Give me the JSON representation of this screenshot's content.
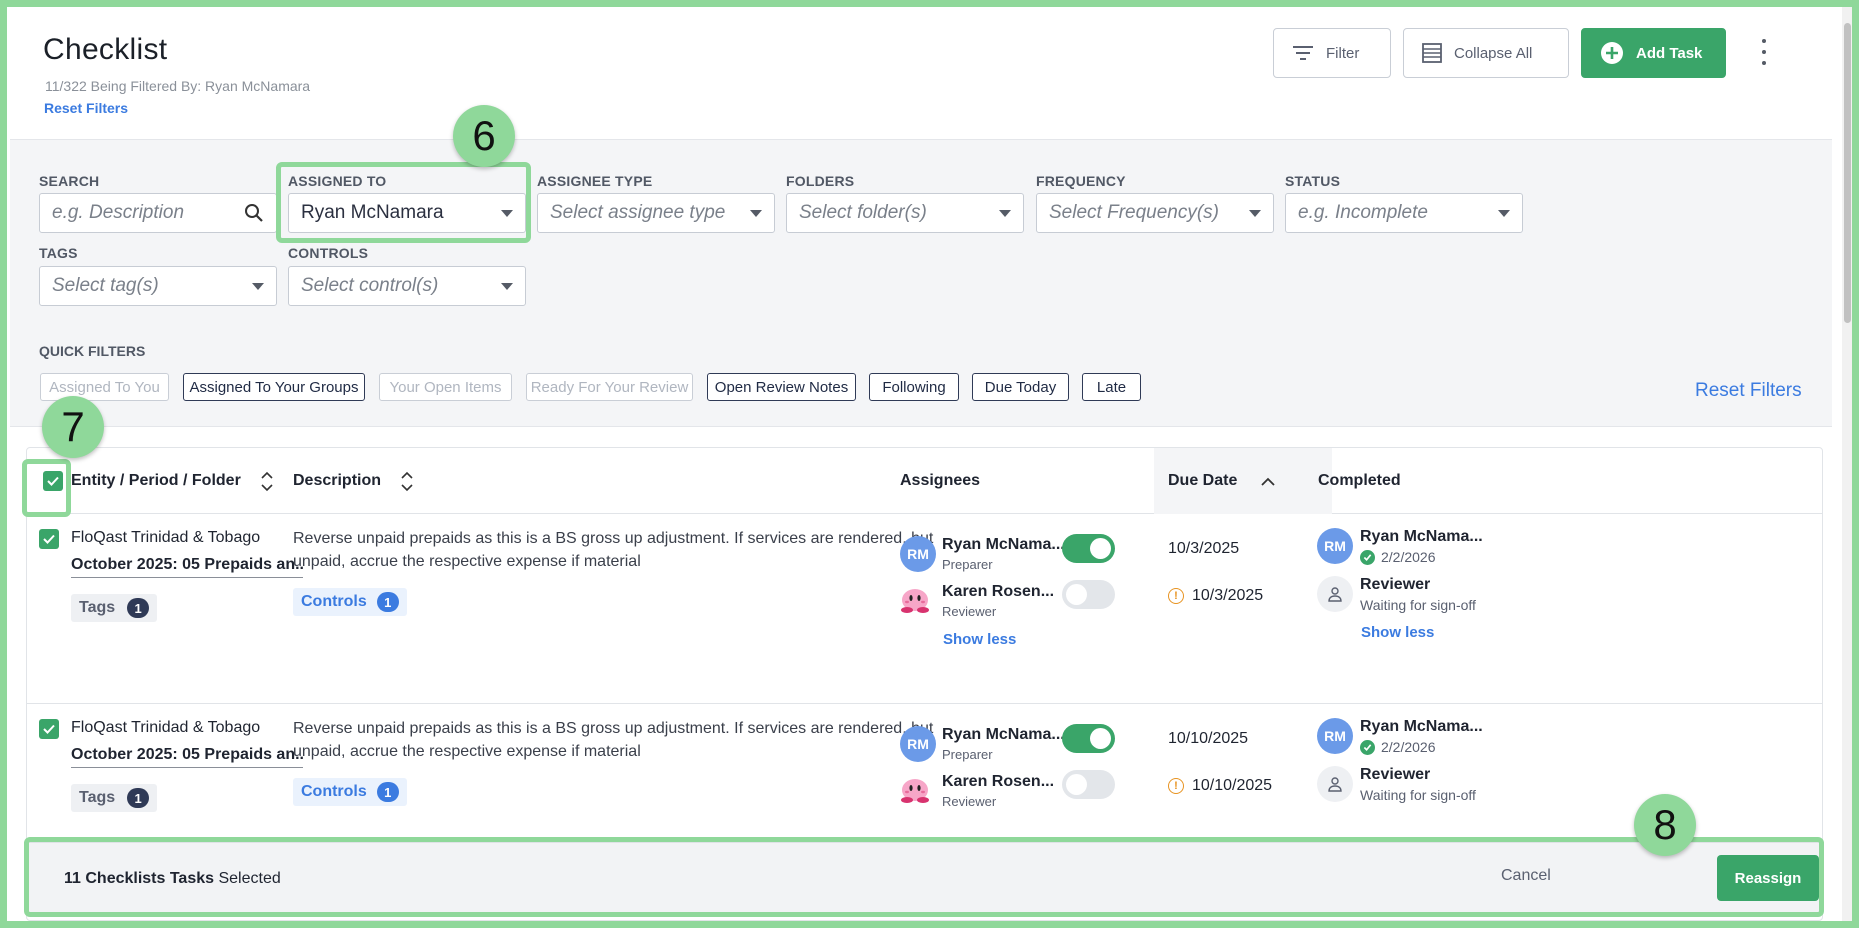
{
  "header": {
    "title": "Checklist",
    "filter_note": "11/322 Being Filtered By: Ryan McNamara",
    "reset_filters": "Reset Filters",
    "filter_label": "Filter",
    "collapse_label": "Collapse All",
    "add_task_label": "Add Task"
  },
  "filters": {
    "search": {
      "label": "SEARCH",
      "placeholder": "e.g. Description"
    },
    "assigned_to": {
      "label": "ASSIGNED TO",
      "value": "Ryan McNamara"
    },
    "assignee_type": {
      "label": "ASSIGNEE TYPE",
      "placeholder": "Select assignee type"
    },
    "folders": {
      "label": "FOLDERS",
      "placeholder": "Select folder(s)"
    },
    "frequency": {
      "label": "FREQUENCY",
      "placeholder": "Select Frequency(s)"
    },
    "status": {
      "label": "STATUS",
      "placeholder": "e.g. Incomplete"
    },
    "tags": {
      "label": "TAGS",
      "placeholder": "Select tag(s)"
    },
    "controls": {
      "label": "CONTROLS",
      "placeholder": "Select control(s)"
    },
    "quick_label": "QUICK FILTERS",
    "quick": [
      "Assigned To You",
      "Assigned To Your Groups",
      "Your Open Items",
      "Ready For Your Review",
      "Open Review Notes",
      "Following",
      "Due Today",
      "Late"
    ],
    "reset": "Reset Filters"
  },
  "table": {
    "headers": {
      "entity": "Entity / Period / Folder",
      "description": "Description",
      "assignees": "Assignees",
      "due_date": "Due Date",
      "completed": "Completed"
    },
    "rows": [
      {
        "entity": "FloQast Trinidad & Tobago",
        "period": "October 2025: 05 Prepaids an...",
        "tags_label": "Tags",
        "tags_count": "1",
        "description": "Reverse unpaid prepaids as this is a BS gross up adjustment. If services are rendered, but unpaid, accrue the respective expense if material",
        "controls_label": "Controls",
        "controls_count": "1",
        "preparer": {
          "initials": "RM",
          "name": "Ryan McNama...",
          "role": "Preparer"
        },
        "reviewer": {
          "name": "Karen Rosen...",
          "role": "Reviewer"
        },
        "show_less": "Show less",
        "due_prep": "10/3/2025",
        "due_rev": "10/3/2025",
        "completed_name": "Ryan McNama...",
        "completed_date": "2/2/2026",
        "reviewer_title": "Reviewer",
        "reviewer_status": "Waiting for sign-off",
        "completed_show_less": "Show less"
      },
      {
        "entity": "FloQast Trinidad & Tobago",
        "period": "October 2025: 05 Prepaids an...",
        "tags_label": "Tags",
        "tags_count": "1",
        "description": "Reverse unpaid prepaids as this is a BS gross up adjustment. If services are rendered, but unpaid, accrue the respective expense if material",
        "controls_label": "Controls",
        "controls_count": "1",
        "preparer": {
          "initials": "RM",
          "name": "Ryan McNama...",
          "role": "Preparer"
        },
        "reviewer": {
          "name": "Karen Rosen...",
          "role": "Reviewer"
        },
        "due_prep": "10/10/2025",
        "due_rev": "10/10/2025",
        "completed_name": "Ryan McNama...",
        "completed_date": "2/2/2026",
        "reviewer_title": "Reviewer",
        "reviewer_status": "Waiting for sign-off"
      }
    ]
  },
  "bottom_bar": {
    "count_label": "11 Checklists Tasks",
    "selected_label": "Selected",
    "cancel": "Cancel",
    "reassign": "Reassign"
  },
  "annotations": {
    "step6": "6",
    "step7": "7",
    "step8": "8"
  },
  "colors": {
    "accent": "#3aa569",
    "link": "#3b7be0",
    "highlight": "#8fd89a"
  }
}
